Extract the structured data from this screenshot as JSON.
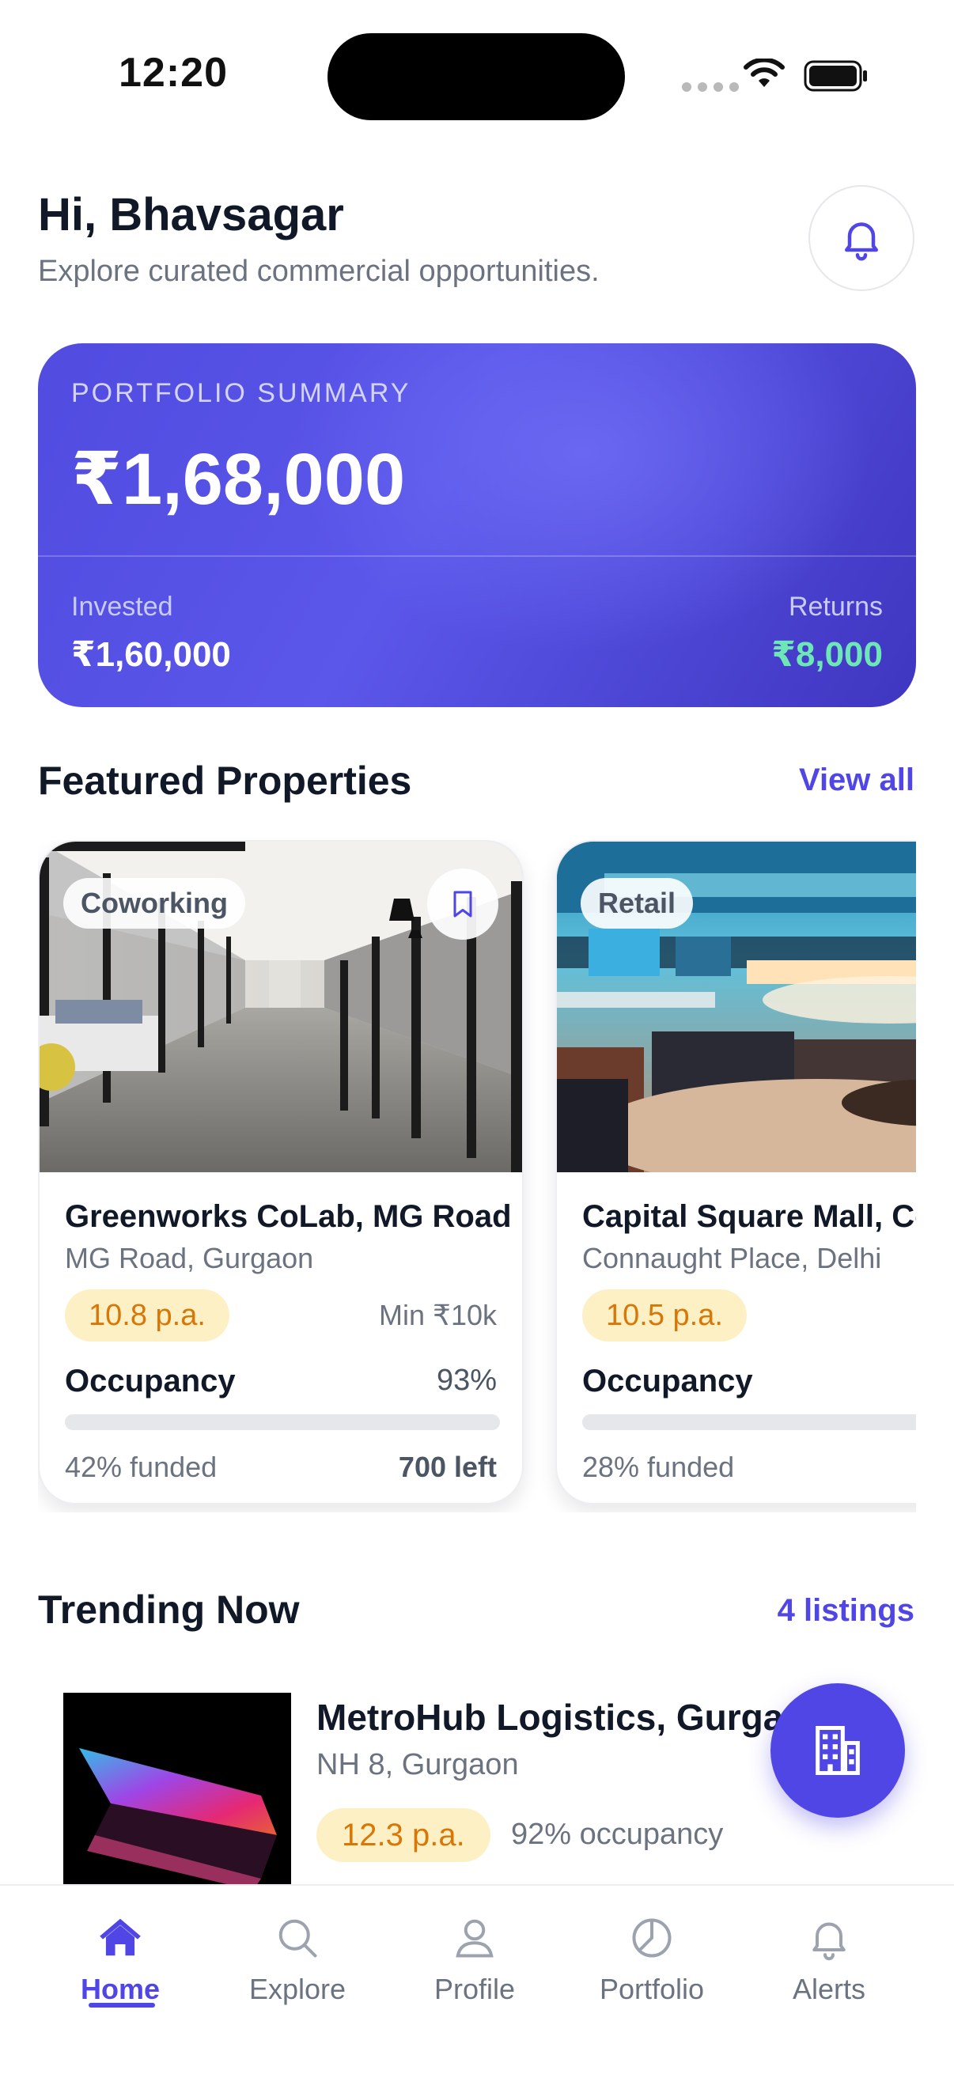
{
  "status_bar": {
    "time": "12:20"
  },
  "header": {
    "greeting": "Hi, Bhavsagar",
    "subtitle": "Explore curated commercial opportunities.",
    "bell_icon": "bell-icon"
  },
  "portfolio": {
    "label": "PORTFOLIO SUMMARY",
    "total": "₹1,68,000",
    "invested_label": "Invested",
    "invested_value": "₹1,60,000",
    "returns_label": "Returns",
    "returns_value": "₹8,000",
    "returns_color": "#6ee7b7"
  },
  "featured": {
    "title": "Featured Properties",
    "link": "View all",
    "cards": [
      {
        "tag": "Coworking",
        "name": "Greenworks CoLab, MG Road",
        "location": "MG Road, Gurgaon",
        "yield": "10.8 p.a.",
        "min": "Min ₹10k",
        "occupancy_label": "Occupancy",
        "occupancy": "93%",
        "funded_fraction": 0.0,
        "funded": "42% funded",
        "left": "700 left"
      },
      {
        "tag": "Retail",
        "name": "Capital Square Mall, Connaught Place",
        "location": "Connaught Place, Delhi",
        "yield": "10.5 p.a.",
        "occupancy_label": "Occupancy",
        "funded_fraction": 0.0,
        "funded": "28% funded"
      }
    ]
  },
  "trending": {
    "title": "Trending Now",
    "link": "4 listings",
    "items": [
      {
        "name": "MetroHub Logistics, Gurgaon",
        "location": "NH 8, Gurgaon",
        "yield": "12.3 p.a.",
        "occupancy": "92% occupancy"
      }
    ]
  },
  "fab": {
    "icon": "building-icon"
  },
  "tabbar": {
    "tabs": [
      {
        "label": "Home",
        "icon": "home-icon",
        "active": true
      },
      {
        "label": "Explore",
        "icon": "search-icon",
        "active": false
      },
      {
        "label": "Profile",
        "icon": "user-icon",
        "active": false
      },
      {
        "label": "Portfolio",
        "icon": "pie-chart-icon",
        "active": false
      },
      {
        "label": "Alerts",
        "icon": "bell-icon",
        "active": false
      }
    ]
  },
  "colors": {
    "accent": "#4f46e5",
    "yield_bg": "#fdf0c4",
    "yield_text": "#d97706"
  }
}
